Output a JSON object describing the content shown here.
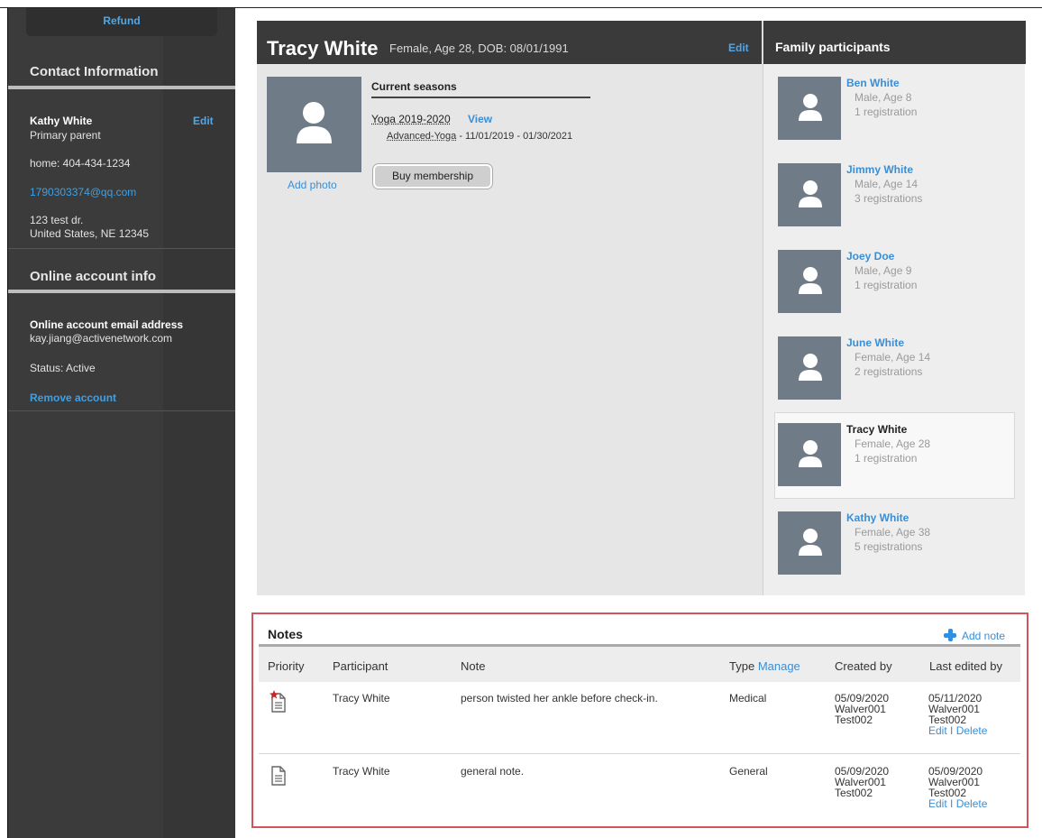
{
  "sidebar": {
    "refund_label": "Refund",
    "contact_heading": "Contact Information",
    "contact_name": "Kathy White",
    "contact_role": "Primary parent",
    "contact_edit": "Edit",
    "phone": "home: 404-434-1234",
    "email": "1790303374@qq.com",
    "address_line1": "123 test dr.",
    "address_line2": "United States, NE 12345",
    "online_heading": "Online account info",
    "online_email_label": "Online account email address",
    "online_email": "kay.jiang@activenetwork.com",
    "status": "Status: Active",
    "remove_account": "Remove account"
  },
  "profile": {
    "name": "Tracy White",
    "details": "Female, Age 28, DOB: 08/01/1991",
    "edit_label": "Edit",
    "add_photo": "Add photo",
    "current_seasons_title": "Current seasons",
    "season_name": "Yoga 2019-2020",
    "view_label": "View",
    "program_name": "Advanced-Yoga",
    "program_dates": " - 11/01/2019 - 01/30/2021",
    "buy_membership": "Buy membership"
  },
  "family": {
    "title": "Family participants",
    "members": [
      {
        "name": "Ben White",
        "info": "Male, Age 8",
        "registrations": "1 registration"
      },
      {
        "name": "Jimmy White",
        "info": "Male, Age 14",
        "registrations": "3 registrations"
      },
      {
        "name": "Joey Doe",
        "info": "Male, Age 9",
        "registrations": "1 registration"
      },
      {
        "name": "June White",
        "info": "Female, Age 14",
        "registrations": "2 registrations"
      },
      {
        "name": "Tracy White",
        "info": "Female, Age 28",
        "registrations": "1 registration"
      },
      {
        "name": "Kathy White",
        "info": "Female, Age 38",
        "registrations": "5 registrations"
      }
    ]
  },
  "notes": {
    "title": "Notes",
    "add_note": "Add note",
    "columns": {
      "priority": "Priority",
      "participant": "Participant",
      "note": "Note",
      "type": "Type",
      "manage": "Manage",
      "created_by": "Created by",
      "last_edited_by": "Last edited by"
    },
    "rows": [
      {
        "participant": "Tracy White",
        "note": "person twisted her ankle before check-in.",
        "type": "Medical",
        "created_date": "05/09/2020",
        "created_user1": "Walver001",
        "created_user2": "Test002",
        "edited_date": "05/11/2020",
        "edited_user1": "Walver001",
        "edited_user2": "Test002",
        "edit": "Edit",
        "sep": " I ",
        "delete": "Delete",
        "priority_flag": true
      },
      {
        "participant": "Tracy White",
        "note": "general note.",
        "type": "General",
        "created_date": "05/09/2020",
        "created_user1": "Walver001",
        "created_user2": "Test002",
        "edited_date": "05/09/2020",
        "edited_user1": "Walver001",
        "edited_user2": "Test002",
        "edit": "Edit",
        "sep": " I ",
        "delete": "Delete",
        "priority_flag": false
      }
    ]
  },
  "colors": {
    "accent_link": "#3a8ed4",
    "sidebar_bg": "#3b3b3b",
    "header_bg": "#3a3a3a",
    "avatar_bg": "#6f7b87",
    "highlight_border": "#d0555a",
    "priority_star": "#d42020"
  },
  "icons": {
    "avatar": "person-silhouette-icon",
    "add_note": "plus-icon",
    "note_doc": "document-icon",
    "priority": "star-icon"
  }
}
